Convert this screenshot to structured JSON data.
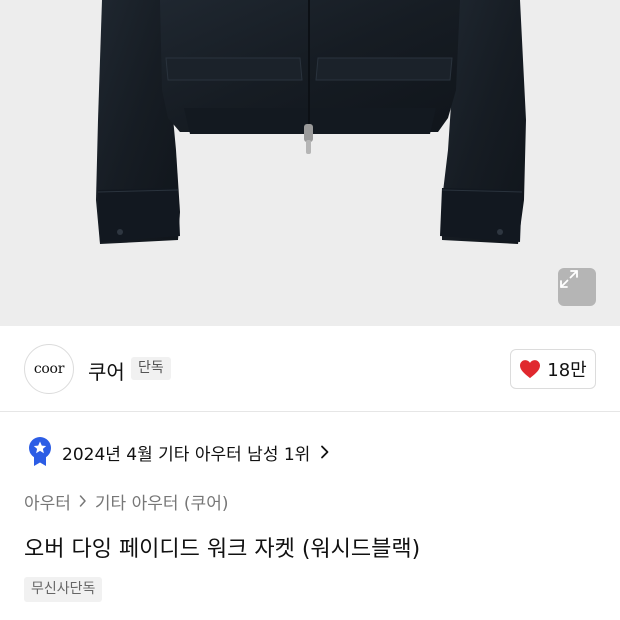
{
  "product": {
    "expand_icon": "expand-icon"
  },
  "brand": {
    "logo_text": "coor",
    "name": "쿠어",
    "badge": "단독"
  },
  "like": {
    "count": "18만",
    "icon": "heart-icon",
    "color": "#e0282e"
  },
  "ranking": {
    "icon": "rank-medal-icon",
    "text": "2024년 4월 기타 아우터 남성 1위",
    "color": "#2c5de5"
  },
  "breadcrumb": {
    "category": "아우터",
    "subcategory": "기타 아우터 (쿠어)"
  },
  "title": "오버 다잉 페이디드 워크 자켓 (워시드블랙)",
  "tags": [
    "무신사단독"
  ]
}
